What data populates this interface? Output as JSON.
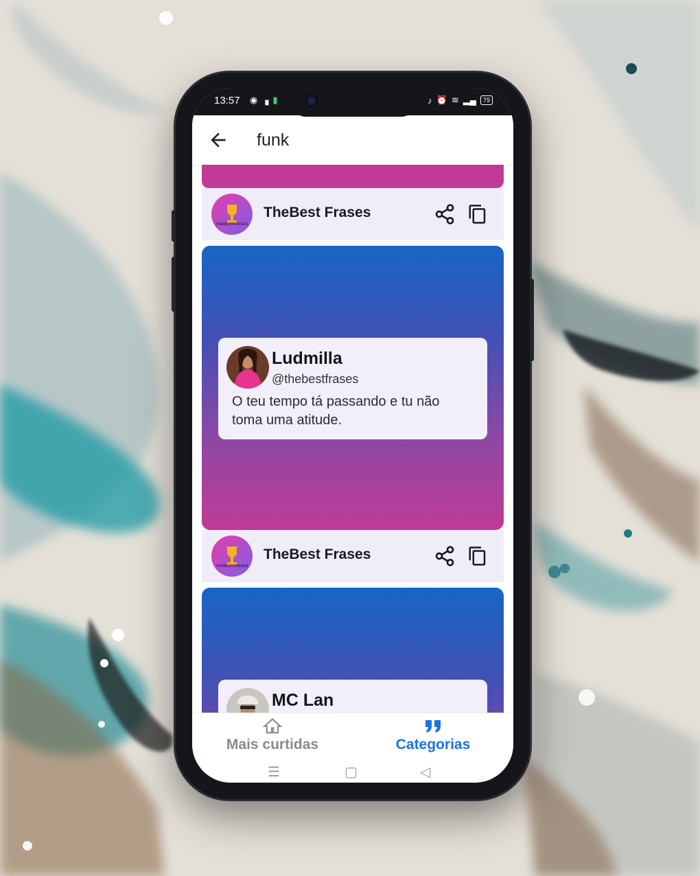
{
  "status_bar": {
    "time": "13:57",
    "battery": "79"
  },
  "app_bar": {
    "title": "funk"
  },
  "post_footer": {
    "name": "TheBest Frases",
    "logo_text": "THEBESTFRASES"
  },
  "cards": [
    {
      "author": "Ludmilla",
      "handle": "@thebestfrases",
      "text": "O teu tempo tá passando e tu não toma uma atitude."
    },
    {
      "author": "MC Lan"
    }
  ],
  "bottom_nav": {
    "items": [
      {
        "label": "Mais curtidas",
        "icon": "home-icon",
        "active": false
      },
      {
        "label": "Categorias",
        "icon": "quote-icon",
        "active": true
      }
    ]
  },
  "colors": {
    "accent": "#1a73e8",
    "inactive": "#8a8a8a",
    "card_top": "#1765c4",
    "card_bottom": "#c03b97",
    "footer_bg": "#f1edf8",
    "tweet_bg": "#f3effa"
  }
}
